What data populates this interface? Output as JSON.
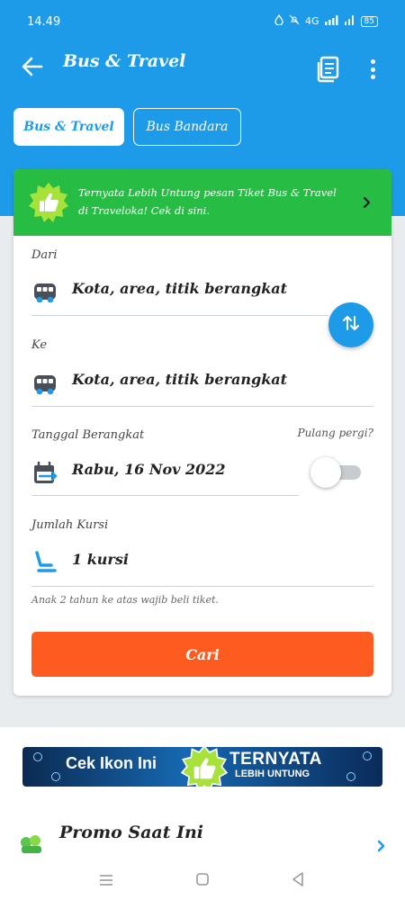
{
  "status_bar": {
    "time": "14.49",
    "signal_text": "4G",
    "battery": "85"
  },
  "app_bar": {
    "title": "Bus & Travel"
  },
  "tabs": [
    {
      "label": "Bus & Travel",
      "active": true
    },
    {
      "label": "Bus Bandara",
      "active": false
    }
  ],
  "promo_banner": {
    "text": "Ternyata Lebih Untung pesan Tiket Bus & Travel di Traveloka! Cek di sini."
  },
  "form": {
    "origin": {
      "label": "Dari",
      "placeholder": "Kota, area, titik berangkat"
    },
    "destination": {
      "label": "Ke",
      "placeholder": "Kota, area, titik berangkat"
    },
    "date": {
      "label": "Tanggal Berangkat",
      "value": "Rabu, 16 Nov 2022"
    },
    "return_trip": {
      "label": "Pulang pergi?",
      "enabled": false
    },
    "seats": {
      "label": "Jumlah Kursi",
      "value": "1 kursi"
    },
    "note": "Anak 2 tahun ke atas wajib beli tiket.",
    "search_label": "Cari"
  },
  "ad_banner": {
    "left_text": "Cek Ikon Ini",
    "right_line1": "TERNYATA",
    "right_line2": "LEBIH UNTUNG"
  },
  "promo_section": {
    "title": "Promo Saat Ini"
  },
  "colors": {
    "primary": "#1e9be8",
    "promo_green": "#27bd45",
    "cta_orange": "#fd5b1f"
  },
  "icons": [
    "back-arrow-icon",
    "bookings-list-icon",
    "more-vert-icon",
    "thumbs-up-badge-icon",
    "chevron-right-icon",
    "bus-icon",
    "swap-icon",
    "calendar-icon",
    "seat-icon"
  ]
}
